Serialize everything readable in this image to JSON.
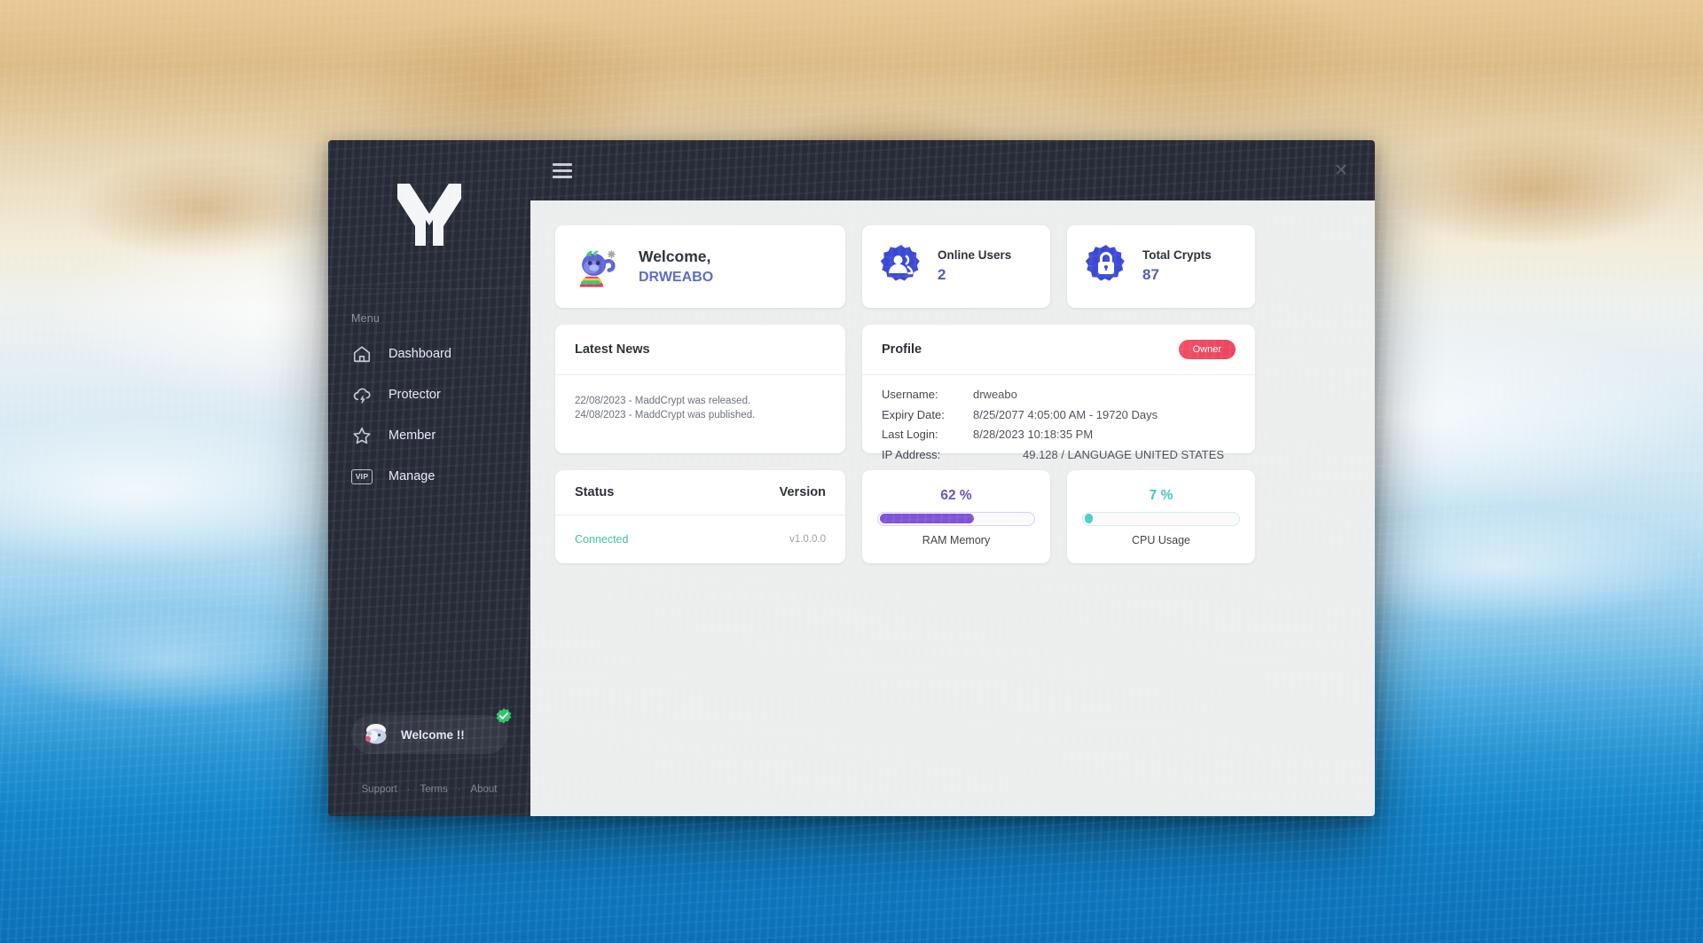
{
  "window": {
    "close_icon": "close-icon",
    "menu_icon": "hamburger-icon"
  },
  "sidebar": {
    "logo": "maddcrypt-m-logo",
    "menu_heading": "Menu",
    "items": [
      {
        "label": "Dashboard",
        "icon": "home-icon"
      },
      {
        "label": "Protector",
        "icon": "cloud-lightning-icon"
      },
      {
        "label": "Member",
        "icon": "star-icon"
      },
      {
        "label": "Manage",
        "icon": "vip-icon"
      }
    ],
    "welcome_pill": {
      "label": "Welcome !!",
      "avatar": "user-avatar",
      "badge": "green-check-badge"
    },
    "footer": {
      "links": [
        "Support",
        "Terms",
        "About"
      ],
      "separator": "·"
    }
  },
  "main": {
    "welcome_card": {
      "mascot": "mascot-avatar",
      "greeting": "Welcome,",
      "username": "DRWEABO"
    },
    "stats": [
      {
        "label": "Online Users",
        "value": "2",
        "icon": "users-badge-icon"
      },
      {
        "label": "Total Crypts",
        "value": "87",
        "icon": "lock-badge-icon"
      }
    ],
    "news": {
      "title": "Latest News",
      "items": [
        "22/08/2023 - MaddCrypt was released.",
        "24/08/2023 - MaddCrypt was published."
      ]
    },
    "profile": {
      "title": "Profile",
      "badge": "Owner",
      "rows": [
        {
          "key": "Username:",
          "value": "drweabo"
        },
        {
          "key": "Expiry Date:",
          "value": "8/25/2077 4:05:00 AM - 19720 Days"
        },
        {
          "key": "Last Login:",
          "value": "8/28/2023 10:18:35 PM"
        },
        {
          "key": "IP Address:",
          "value": "49.128 / LANGUAGE UNITED STATES"
        }
      ]
    },
    "status": {
      "col_status": "Status",
      "col_version": "Version",
      "status_value": "Connected",
      "version_value": "v1.0.0.0"
    },
    "meters": [
      {
        "pct_text": "62 %",
        "pct": 62,
        "label": "RAM Memory",
        "color": "#7d54d4"
      },
      {
        "pct_text": "7 %",
        "pct": 7,
        "label": "CPU Usage",
        "color": "#4ccfc8"
      }
    ]
  },
  "colors": {
    "sidebar_bg": "#272b38",
    "accent_blue": "#4a5bbd",
    "owner_red": "#e8445c",
    "connected_teal": "#3fbfa8",
    "ram_purple": "#7d54d4",
    "cpu_teal": "#4ccfc8"
  }
}
